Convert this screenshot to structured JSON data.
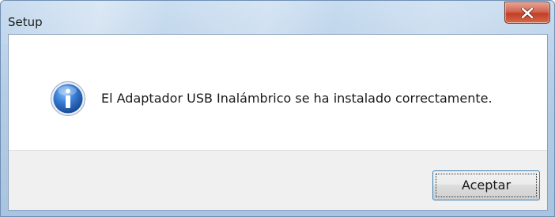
{
  "window": {
    "title": "Setup",
    "close_icon": "close-icon"
  },
  "dialog": {
    "icon": "info-icon",
    "message": "El Adaptador USB Inalámbrico se ha instalado correctamente.",
    "ok_label": "Aceptar"
  },
  "colors": {
    "close_button": "#c7452b",
    "info_icon": "#2d6bc4",
    "button_focus_border": "#3c7fb1"
  }
}
